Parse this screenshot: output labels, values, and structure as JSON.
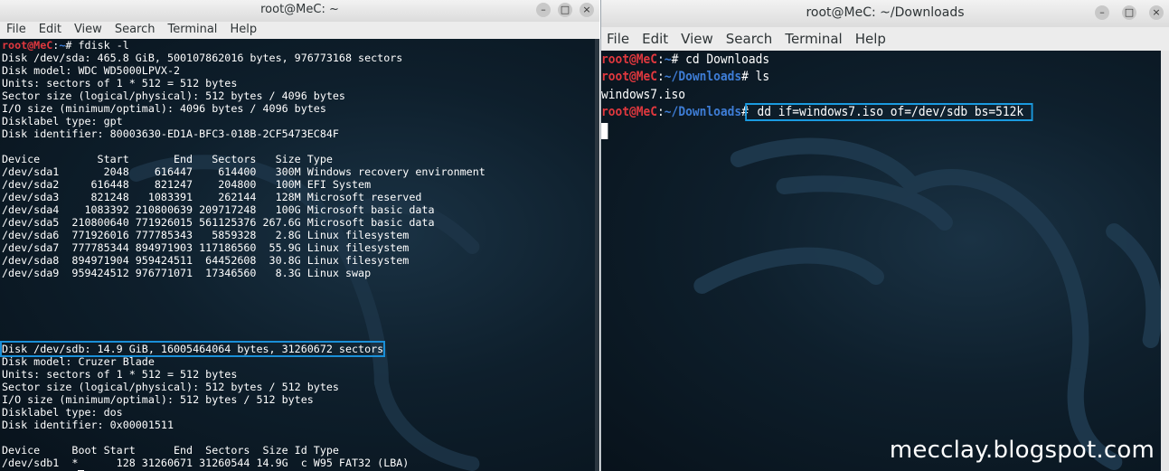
{
  "left_window": {
    "title": "root@MeC: ~",
    "controls": [
      "minimize-icon",
      "maximize-icon",
      "close-icon"
    ],
    "menu": [
      "File",
      "Edit",
      "View",
      "Search",
      "Terminal",
      "Help"
    ],
    "prompt": {
      "user": "root@MeC",
      "sep": ":",
      "path": "~",
      "sym": "# "
    },
    "command": "fdisk -l",
    "sda_header": "Disk /dev/sda: 465.8 GiB, 500107862016 bytes, 976773168 sectors",
    "sda_info": [
      "Disk model: WDC WD5000LPVX-2",
      "Units: sectors of 1 * 512 = 512 bytes",
      "Sector size (logical/physical): 512 bytes / 4096 bytes",
      "I/O size (minimum/optimal): 4096 bytes / 4096 bytes",
      "Disklabel type: gpt",
      "Disk identifier: 80003630-ED1A-BFC3-018B-2CF5473EC84F"
    ],
    "sda_table_header": "Device         Start       End   Sectors   Size Type",
    "sda_rows": [
      "/dev/sda1       2048    616447    614400   300M Windows recovery environment",
      "/dev/sda2     616448    821247    204800   100M EFI System",
      "/dev/sda3     821248   1083391    262144   128M Microsoft reserved",
      "/dev/sda4    1083392 210800639 209717248   100G Microsoft basic data",
      "/dev/sda5  210800640 771926015 561125376 267.6G Microsoft basic data",
      "/dev/sda6  771926016 777785343   5859328   2.8G Linux filesystem",
      "/dev/sda7  777785344 894971903 117186560  55.9G Linux filesystem",
      "/dev/sda8  894971904 959424511  64452608  30.8G Linux filesystem",
      "/dev/sda9  959424512 976771071  17346560   8.3G Linux swap"
    ],
    "sdb_header": "Disk /dev/sdb: 14.9 GiB, 16005464064 bytes, 31260672 sectors",
    "sdb_info": [
      "Disk model: Cruzer Blade",
      "Units: sectors of 1 * 512 = 512 bytes",
      "Sector size (logical/physical): 512 bytes / 512 bytes",
      "I/O size (minimum/optimal): 512 bytes / 512 bytes",
      "Disklabel type: dos",
      "Disk identifier: 0x00001511"
    ],
    "sdb_table_header": "Device     Boot Start      End  Sectors  Size Id Type",
    "sdb_rows": [
      "/dev/sdb1  *      128 31260671 31260544 14.9G  c W95 FAT32 (LBA)"
    ]
  },
  "right_window": {
    "title": "root@MeC: ~/Downloads",
    "controls": [
      "minimize-icon",
      "maximize-icon",
      "close-icon"
    ],
    "menu": [
      "File",
      "Edit",
      "View",
      "Search",
      "Terminal",
      "Help"
    ],
    "lines": [
      {
        "user": "root@MeC",
        "sep": ":",
        "path": "~",
        "sym": "# ",
        "cmd": "cd Downloads"
      },
      {
        "user": "root@MeC",
        "sep": ":",
        "path": "~/Downloads",
        "sym": "# ",
        "cmd": "ls"
      }
    ],
    "output": "windows7.iso",
    "last_prompt": {
      "user": "root@MeC",
      "sep": ":",
      "path": "~/Downloads",
      "sym": "#"
    },
    "dd_command": " dd if=windows7.iso of=/dev/sdb bs=512k"
  },
  "watermark_text": "mecclay.blogspot.com",
  "colors": {
    "highlight": "#1a8fd8",
    "prompt_user": "#e0383e",
    "prompt_path": "#3e7dd6",
    "terminal_bg": "#0e1f2c"
  }
}
